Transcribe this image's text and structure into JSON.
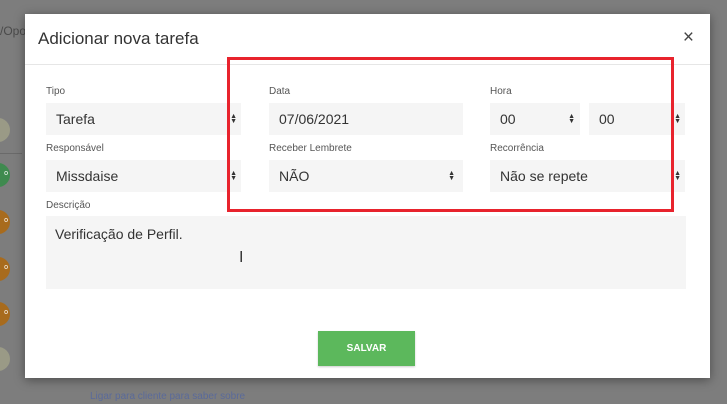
{
  "background": {
    "partial_top_text": "/Opo",
    "partial_bottom_text": "Ligar para cliente para saber sobre",
    "circle_badge_text": "o"
  },
  "modal": {
    "title": "Adicionar nova tarefa",
    "close_icon": "×",
    "fields": {
      "tipo": {
        "label": "Tipo",
        "value": "Tarefa"
      },
      "data": {
        "label": "Data",
        "value": "07/06/2021"
      },
      "hora": {
        "label": "Hora",
        "hour": "00",
        "minute": "00"
      },
      "responsavel": {
        "label": "Responsável",
        "value": "Missdaise"
      },
      "lembrete": {
        "label": "Receber Lembrete",
        "value": "NÃO"
      },
      "recorrencia": {
        "label": "Recorrência",
        "value": "Não se repete"
      },
      "descricao": {
        "label": "Descrição",
        "value": "Verificação de Perfil."
      }
    },
    "save_label": "SALVAR"
  },
  "colors": {
    "save_button": "#5cb85c",
    "highlight": "#e8232d"
  }
}
